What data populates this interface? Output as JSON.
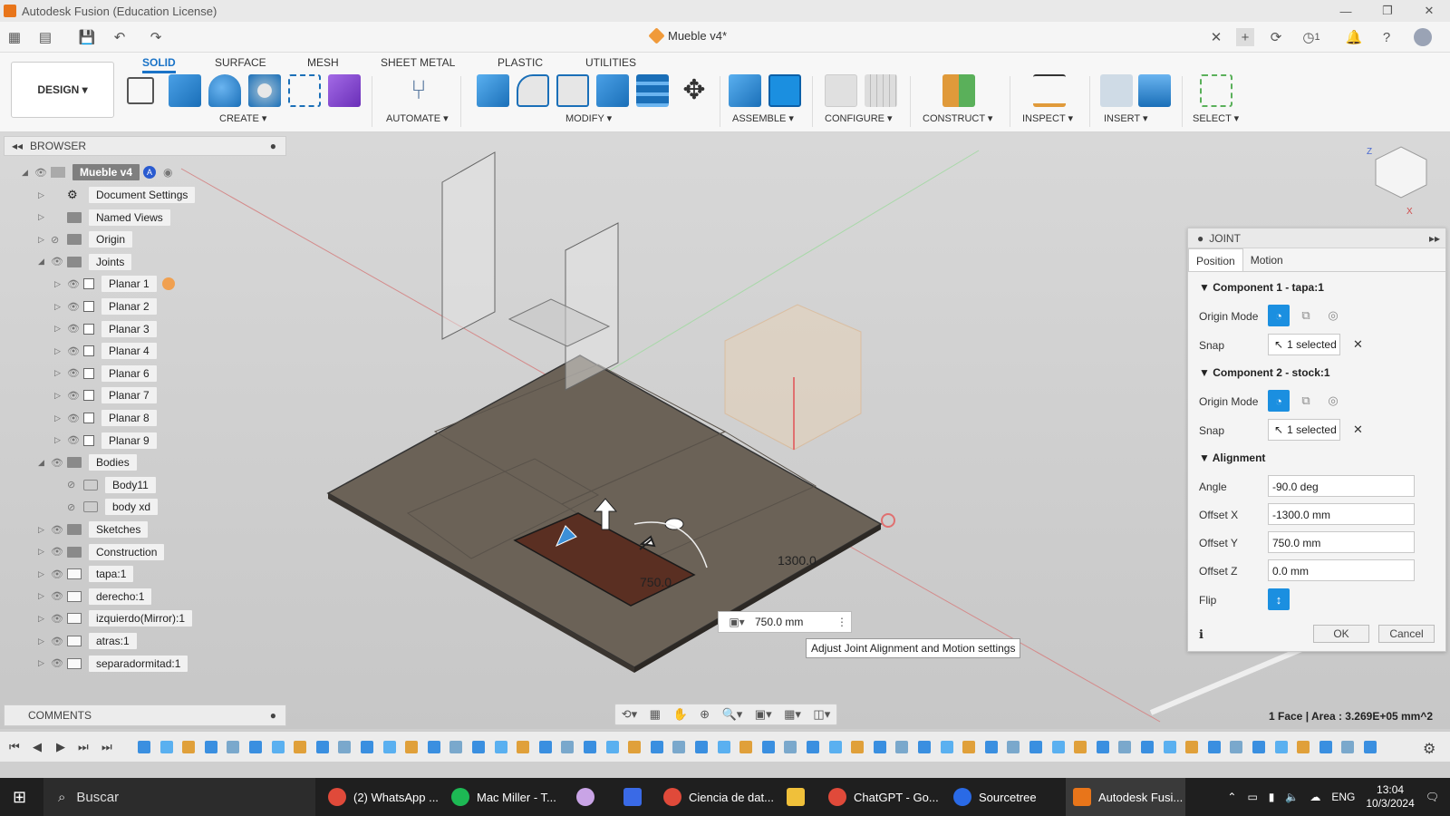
{
  "window": {
    "title": "Autodesk Fusion (Education License)"
  },
  "document": {
    "tab_title": "Mueble v4*"
  },
  "ribbon": {
    "workspace": "DESIGN ▾",
    "tabs": [
      "SOLID",
      "SURFACE",
      "MESH",
      "SHEET METAL",
      "PLASTIC",
      "UTILITIES"
    ],
    "groups": [
      "CREATE ▾",
      "AUTOMATE ▾",
      "MODIFY ▾",
      "ASSEMBLE ▾",
      "CONFIGURE ▾",
      "CONSTRUCT ▾",
      "INSPECT ▾",
      "INSERT ▾",
      "SELECT ▾"
    ]
  },
  "browser": {
    "title": "BROWSER",
    "root": "Mueble v4",
    "items": [
      {
        "label": "Document Settings"
      },
      {
        "label": "Named Views"
      },
      {
        "label": "Origin"
      },
      {
        "label": "Joints"
      },
      {
        "label": "Planar 1"
      },
      {
        "label": "Planar 2"
      },
      {
        "label": "Planar 3"
      },
      {
        "label": "Planar 4"
      },
      {
        "label": "Planar 6"
      },
      {
        "label": "Planar 7"
      },
      {
        "label": "Planar 8"
      },
      {
        "label": "Planar 9"
      },
      {
        "label": "Bodies"
      },
      {
        "label": "Body11"
      },
      {
        "label": "body xd"
      },
      {
        "label": "Sketches"
      },
      {
        "label": "Construction"
      },
      {
        "label": "tapa:1"
      },
      {
        "label": "derecho:1"
      },
      {
        "label": "izquierdo(Mirror):1"
      },
      {
        "label": "atras:1"
      },
      {
        "label": "separadormitad:1"
      }
    ]
  },
  "comments": {
    "title": "COMMENTS"
  },
  "joint_panel": {
    "title": "JOINT",
    "tabs": [
      "Position",
      "Motion"
    ],
    "component1": {
      "title": "Component 1 - tapa:1",
      "origin_mode_label": "Origin Mode",
      "snap_label": "Snap",
      "snap_value": "1 selected"
    },
    "component2": {
      "title": "Component 2 - stock:1",
      "origin_mode_label": "Origin Mode",
      "snap_label": "Snap",
      "snap_value": "1 selected"
    },
    "alignment": {
      "title": "Alignment",
      "angle_label": "Angle",
      "angle": "-90.0 deg",
      "offset_x_label": "Offset X",
      "offset_x": "-1300.0 mm",
      "offset_y_label": "Offset Y",
      "offset_y": "750.0 mm",
      "offset_z_label": "Offset Z",
      "offset_z": "0.0 mm",
      "flip_label": "Flip"
    },
    "ok": "OK",
    "cancel": "Cancel"
  },
  "viewport": {
    "dim_label_1": "1300.0",
    "dim_label_2": "750.0",
    "distance_input": "750.0 mm",
    "tooltip": "Adjust Joint Alignment and Motion settings",
    "status": "1 Face | Area : 3.269E+05 mm^2"
  },
  "taskbar": {
    "search": "Buscar",
    "apps": [
      "(2) WhatsApp ...",
      "Mac Miller - T...",
      "Ciencia de dat...",
      "ChatGPT - Go...",
      "Sourcetree",
      "Autodesk Fusi..."
    ],
    "lang": "ENG",
    "time": "13:04",
    "date": "10/3/2024",
    "notifications": "1"
  },
  "colors": {
    "accent": "#1a73c7",
    "active_mode": "#1b8fe0",
    "wood": "#5a2f22",
    "plate": "#6b6257"
  }
}
